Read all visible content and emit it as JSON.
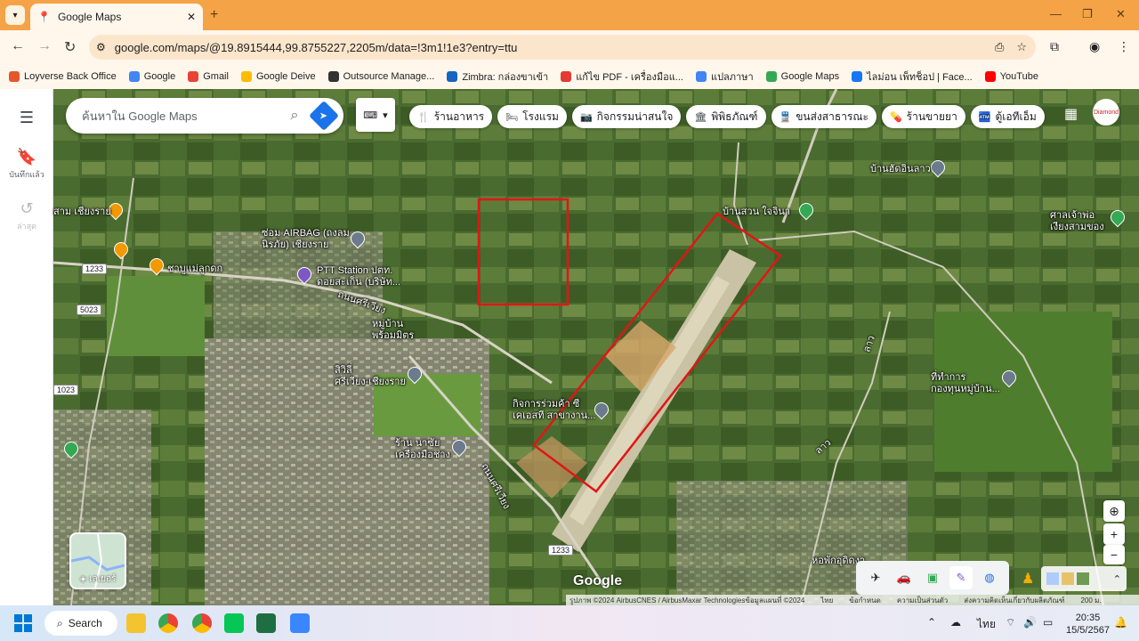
{
  "browser": {
    "tab_title": "Google Maps",
    "url": "google.com/maps/@19.8915444,99.8755227,2205m/data=!3m1!1e3?entry=ttu",
    "bookmarks": [
      {
        "label": "Loyverse Back Office",
        "color": "#e8552b"
      },
      {
        "label": "Google",
        "color": "#4285f4"
      },
      {
        "label": "Gmail",
        "color": "#ea4335"
      },
      {
        "label": "Google Deive",
        "color": "#fbbc04"
      },
      {
        "label": "Outsource Manage...",
        "color": "#333333"
      },
      {
        "label": "Zimbra: กล่องขาเข้า",
        "color": "#1565c0"
      },
      {
        "label": "แก้ไข PDF - เครื่องมือแ...",
        "color": "#e53935"
      },
      {
        "label": "แปลภาษา",
        "color": "#4285f4"
      },
      {
        "label": "Google Maps",
        "color": "#34a853"
      },
      {
        "label": "ไลม่อน เพ็ทช็อป | Face...",
        "color": "#1877f2"
      },
      {
        "label": "YouTube",
        "color": "#ff0000"
      }
    ]
  },
  "sidebar": {
    "saved_label": "บันทึกแล้ว",
    "recent_label": "ล่าสุด"
  },
  "maps": {
    "search_placeholder": "ค้นหาใน Google Maps",
    "chips": [
      {
        "icon": "🍴",
        "label": "ร้านอาหาร"
      },
      {
        "icon": "🛏",
        "label": "โรงแรม"
      },
      {
        "icon": "📷",
        "label": "กิจกรรมน่าสนใจ"
      },
      {
        "icon": "🏛",
        "label": "พิพิธภัณฑ์"
      },
      {
        "icon": "🚆",
        "label": "ขนส่งสาธารณะ"
      },
      {
        "icon": "💊",
        "label": "ร้านขายยา"
      },
      {
        "icon": "🏧",
        "label": "ตู้เอทีเอ็ม"
      }
    ],
    "avatar_text": "Diamond",
    "places": {
      "p1": "ซ่อม AIRBAG (ถงลม\nนิรภัย) เชียงราย",
      "p2": "PTT Station ปตท.\nดอยสะเก็น (บริษัท...",
      "p3": "หมู่บ้าน\nพร้อมมิตร",
      "p4": "สิวิลี่\nศรีเวียง-เชียงราย",
      "p5": "กิจการร่วมค้า ซี\nเคเอสที สาขางาน...",
      "p6": "ร้าน นาซัย\nเครื่องมือช่าง",
      "p7": "บ้านสวน ใจจินา",
      "p8": "บ้านฮัดอินลาว",
      "p9": "ศาลเจ้าพ่อ\nเงียงสามของ",
      "p10": "ที่ทำการ\nกองทุนหมู่บ้าน...",
      "p11": "ชาบูแม่ลูกดก",
      "p12": "สาม เชียงราย",
      "p13": "หอพักอุดิดงา",
      "road1": "ถนนศรีเวียง",
      "road2": "ถนนศรีเวียง",
      "road3": "ลาว",
      "road4": "ลาว"
    },
    "road_shields": [
      "1233",
      "5023",
      "1233",
      "1023"
    ],
    "layers_label": "เลเยอร์",
    "google_logo": "Google",
    "attribution": [
      "รูปภาพ ©2024 AirbusCNES / AirbusMaxar Technologiesข้อมูลแผนที่ ©2024",
      "ไทย",
      "ข้อกำหนด",
      "ความเป็นส่วนตัว",
      "ส่งความคิดเห็นเกี่ยวกับผลิตภัณฑ์",
      "200 ม."
    ]
  },
  "taskbar": {
    "search_label": "Search",
    "lang": "ไทย",
    "time": "20:35",
    "date": "15/5/2567"
  },
  "colors": {
    "tabbar": "#f5a347",
    "annotation_red": "#e01616"
  }
}
